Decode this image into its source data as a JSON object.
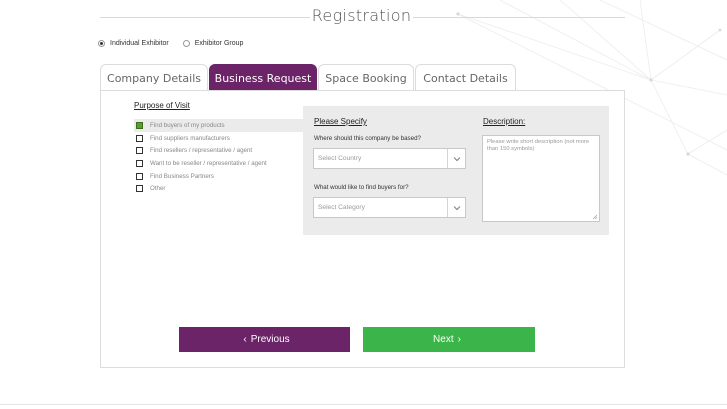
{
  "page": {
    "title": "Registration",
    "exhibitor_type": {
      "options": [
        {
          "label": "Individual Exhibitor",
          "selected": true
        },
        {
          "label": "Exhibitor Group",
          "selected": false
        }
      ]
    }
  },
  "tabs": [
    {
      "label": "Company Details",
      "active": false
    },
    {
      "label": "Business Request",
      "active": true
    },
    {
      "label": "Space Booking",
      "active": false
    },
    {
      "label": "Contact Details",
      "active": false
    }
  ],
  "purpose": {
    "title": "Purpose of Visit",
    "items": [
      {
        "label": "Find buyers of my products",
        "checked": true
      },
      {
        "label": "Find suppliers manufacturers",
        "checked": false
      },
      {
        "label": "Find resellers / representative / agent",
        "checked": false
      },
      {
        "label": "Want to be reseller / representative / agent",
        "checked": false
      },
      {
        "label": "Find Business Partners",
        "checked": false
      },
      {
        "label": "Other",
        "checked": false
      }
    ]
  },
  "specify": {
    "title": "Please Specify",
    "country_question": "Where should this company be based?",
    "country_value": "Select Country",
    "category_question": "What would like to find buyers for?",
    "category_value": "Select Category"
  },
  "description": {
    "title": "Description:",
    "placeholder": "Please write short description (not more than 150 symbols)"
  },
  "nav": {
    "previous_label": "Previous",
    "previous_glyph": "‹",
    "next_label": "Next",
    "next_glyph": "›"
  },
  "colors": {
    "brand_purple": "#6b2467",
    "next_green": "#3bb54a",
    "checked_green": "#5a9c2e"
  }
}
